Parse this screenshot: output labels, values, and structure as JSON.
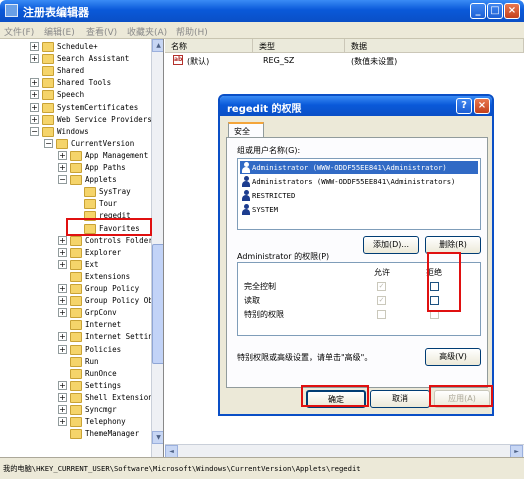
{
  "window": {
    "title": "注册表编辑器",
    "btn_min": "_",
    "btn_max": "□",
    "btn_close": "×"
  },
  "menu": [
    "文件(F)",
    "编辑(E)",
    "查看(V)",
    "收藏夹(A)",
    "帮助(H)"
  ],
  "tree": {
    "items": [
      {
        "label": "Schedule+",
        "expander": "+"
      },
      {
        "label": "Search Assistant",
        "expander": "+"
      },
      {
        "label": "Shared",
        "expander": ""
      },
      {
        "label": "Shared Tools",
        "expander": "+"
      },
      {
        "label": "Speech",
        "expander": "+"
      },
      {
        "label": "SystemCertificates",
        "expander": "+"
      },
      {
        "label": "Web Service Providers",
        "expander": "+"
      },
      {
        "label": "Windows",
        "expander": "−"
      },
      {
        "label": "CurrentVersion",
        "expander": "−"
      },
      {
        "label": "App Management",
        "expander": "+"
      },
      {
        "label": "App Paths",
        "expander": "+"
      },
      {
        "label": "Applets",
        "expander": "−"
      },
      {
        "label": "SysTray",
        "expander": ""
      },
      {
        "label": "Tour",
        "expander": ""
      },
      {
        "label": "regedit",
        "expander": ""
      },
      {
        "label": "Favorites",
        "expander": ""
      },
      {
        "label": "Controls Folder",
        "expander": "+"
      },
      {
        "label": "Explorer",
        "expander": "+"
      },
      {
        "label": "Ext",
        "expander": "+"
      },
      {
        "label": "Extensions",
        "expander": ""
      },
      {
        "label": "Group Policy",
        "expander": "+"
      },
      {
        "label": "Group Policy Objects",
        "expander": "+"
      },
      {
        "label": "GrpConv",
        "expander": "+"
      },
      {
        "label": "Internet",
        "expander": ""
      },
      {
        "label": "Internet Settings",
        "expander": "+"
      },
      {
        "label": "Policies",
        "expander": "+"
      },
      {
        "label": "Run",
        "expander": ""
      },
      {
        "label": "RunOnce",
        "expander": ""
      },
      {
        "label": "Settings",
        "expander": "+"
      },
      {
        "label": "Shell Extensions",
        "expander": "+"
      },
      {
        "label": "Syncmgr",
        "expander": "+"
      },
      {
        "label": "Telephony",
        "expander": "+"
      },
      {
        "label": "ThemeManager",
        "expander": ""
      }
    ]
  },
  "list": {
    "headers": [
      "名称",
      "类型",
      "数据"
    ],
    "rows": [
      {
        "icon": "ab",
        "name": "(默认)",
        "type": "REG_SZ",
        "data": "(数值未设置)"
      }
    ]
  },
  "scroll": {
    "up": "▲",
    "down": "▼",
    "left": "◄",
    "right": "►"
  },
  "statusbar": "我的电脑\\HKEY_CURRENT_USER\\Software\\Microsoft\\Windows\\CurrentVersion\\Applets\\regedit",
  "dialog": {
    "title": "regedit 的权限",
    "help_btn": "?",
    "close_btn": "×",
    "tab": "安全",
    "users_label": "组或用户名称(G):",
    "users": [
      "Administrator (WWW-ODDF55EE841\\Administrator)",
      "Administrators (WWW-ODDF55EE841\\Administrators)",
      "RESTRICTED",
      "SYSTEM"
    ],
    "add_btn": "添加(D)...",
    "remove_btn": "删除(R)",
    "perm_label": "Administrator 的权限(P)",
    "allow_col": "允许",
    "deny_col": "拒绝",
    "permissions": [
      {
        "name": "完全控制",
        "allow": true,
        "deny": false
      },
      {
        "name": "读取",
        "allow": true,
        "deny": false
      },
      {
        "name": "特别的权限",
        "allow": false,
        "deny": false
      }
    ],
    "checkmark": "✓",
    "advanced_note": "特别权限或高级设置，请单击\"高级\"。",
    "advanced_btn": "高级(V)",
    "ok_btn": "确定",
    "cancel_btn": "取消",
    "apply_btn": "应用(A)"
  },
  "colors": {
    "highlight": "#e01010",
    "selection": "#316ac5",
    "titlebar": "#0a59d9"
  }
}
